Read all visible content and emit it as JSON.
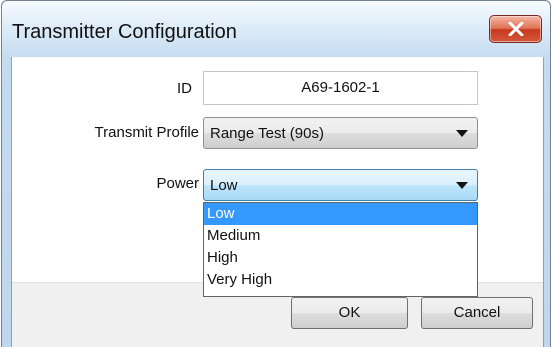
{
  "window": {
    "title": "Transmitter Configuration"
  },
  "form": {
    "id": {
      "label": "ID",
      "value": "A69-1602-1"
    },
    "transmit_profile": {
      "label": "Transmit Profile",
      "selected": "Range Test (90s)"
    },
    "power": {
      "label": "Power",
      "selected": "Low",
      "options": [
        "Low",
        "Medium",
        "High",
        "Very High"
      ],
      "highlighted_option": "Low"
    }
  },
  "buttons": {
    "ok_label": "OK",
    "cancel_label": "Cancel"
  },
  "colors": {
    "selection_highlight": "#3399ff",
    "close_button": "#d2583c"
  }
}
